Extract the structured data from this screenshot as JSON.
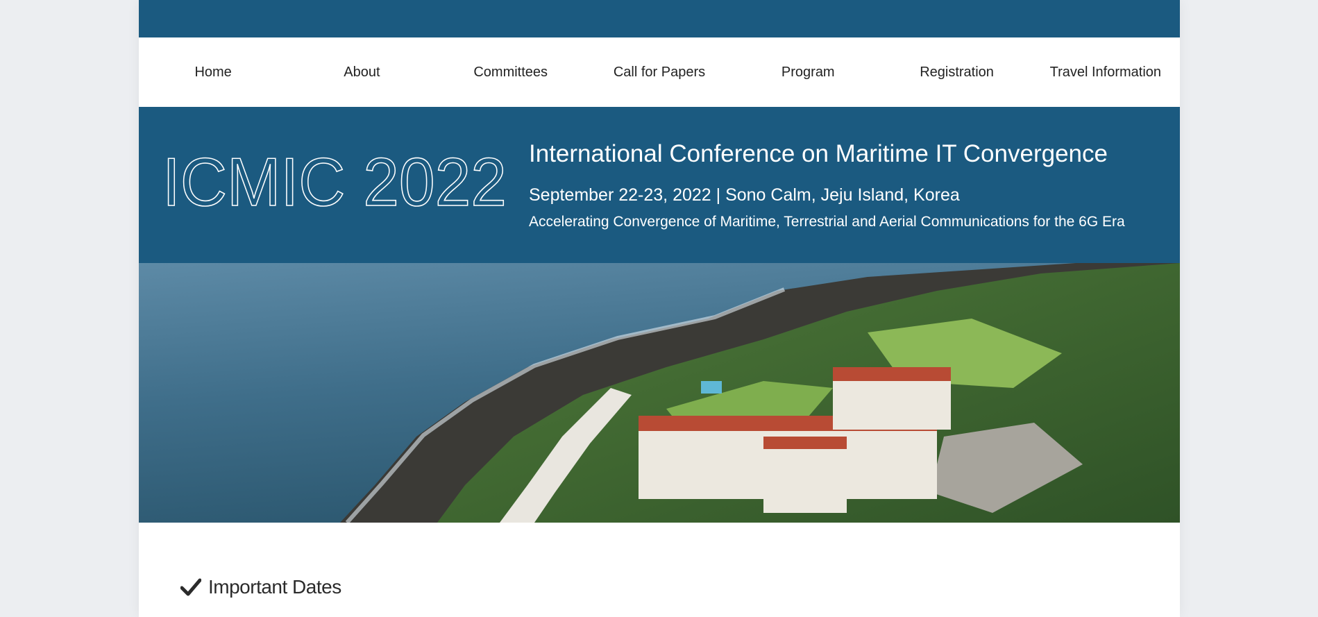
{
  "nav": {
    "items": [
      {
        "label": "Home"
      },
      {
        "label": "About"
      },
      {
        "label": "Committees"
      },
      {
        "label": "Call for Papers"
      },
      {
        "label": "Program"
      },
      {
        "label": "Registration"
      },
      {
        "label": "Travel Information"
      }
    ]
  },
  "banner": {
    "logo_text": "ICMIC 2022",
    "title": "International Conference on Maritime IT Convergence",
    "date_location": "September 22-23, 2022 | Sono Calm, Jeju Island, Korea",
    "tagline": "Accelerating Convergence of Maritime, Terrestrial and Aerial Communications for the 6G Era"
  },
  "hero": {
    "image": "aerial-coastal-resort-photo"
  },
  "section": {
    "icon": "check-icon",
    "title": "Important Dates"
  },
  "colors": {
    "brand_blue": "#1b5a80",
    "page_background": "#eceef1"
  }
}
